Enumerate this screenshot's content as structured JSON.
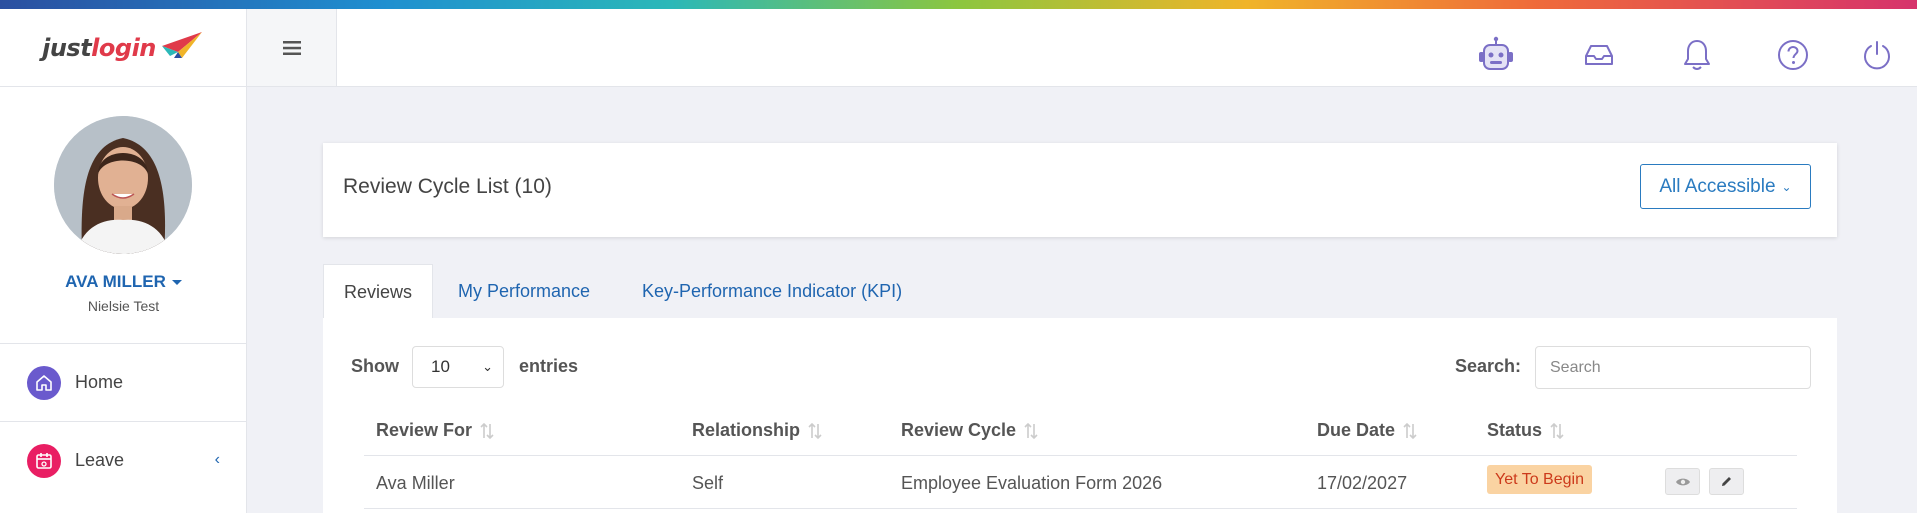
{
  "brand": {
    "logo_part1": "just",
    "logo_part2": "login"
  },
  "topbar": {
    "menu_icon": "hamburger-icon",
    "icons": [
      "robot-icon",
      "inbox-icon",
      "bell-icon",
      "help-icon",
      "power-icon"
    ]
  },
  "user": {
    "name": "AVA MILLER",
    "company": "Nielsie Test"
  },
  "sidebar": {
    "items": [
      {
        "label": "Home",
        "icon": "home-icon",
        "color": "#6a5acd"
      },
      {
        "label": "Leave",
        "icon": "calendar-icon",
        "color": "#e91e63"
      }
    ]
  },
  "header": {
    "title": "Review Cycle List (10)",
    "scope_label": "All Accessible"
  },
  "tabs": [
    {
      "label": "Reviews",
      "active": true
    },
    {
      "label": "My Performance",
      "active": false
    },
    {
      "label": "Key-Performance Indicator (KPI)",
      "active": false
    }
  ],
  "table_controls": {
    "show_label": "Show",
    "entries_value": "10",
    "entries_label": "entries",
    "search_label": "Search:",
    "search_placeholder": "Search"
  },
  "table": {
    "columns": [
      "Review For",
      "Relationship",
      "Review Cycle",
      "Due Date",
      "Status"
    ],
    "rows": [
      {
        "review_for": "Ava Miller",
        "relationship": "Self",
        "review_cycle": "Employee Evaluation Form 2026",
        "due_date": "17/02/2027",
        "status": "Yet To Begin"
      }
    ]
  },
  "colors": {
    "accent": "#1f65b0",
    "status_bg": "#fad3a2",
    "status_text": "#cc3a1b"
  }
}
